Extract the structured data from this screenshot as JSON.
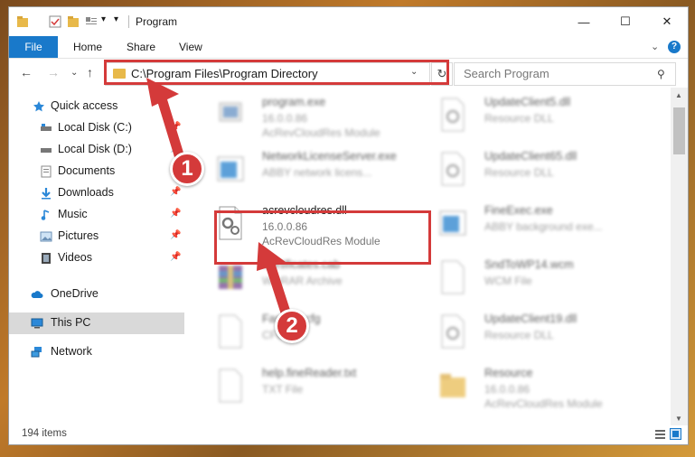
{
  "window": {
    "title": "Program",
    "minimize": "—",
    "maximize": "☐",
    "close": "✕"
  },
  "ribbon": {
    "tabs": [
      "File",
      "Home",
      "Share",
      "View"
    ],
    "expand": "⌄",
    "help": "?"
  },
  "address": {
    "back": "←",
    "forward": "→",
    "dropdown": "⌄",
    "up": "↑",
    "path": "C:\\Program Files\\Program Directory",
    "path_dropdown": "⌄",
    "refresh": "↻",
    "search_placeholder": "Search Program",
    "search_icon": "⚲"
  },
  "sidebar": {
    "items": [
      {
        "label": "Quick access",
        "icon": "star-icon"
      },
      {
        "label": "Local Disk (C:)",
        "icon": "drive-icon"
      },
      {
        "label": "Local Disk (D:)",
        "icon": "drive-icon"
      },
      {
        "label": "Documents",
        "icon": "documents-icon"
      },
      {
        "label": "Downloads",
        "icon": "download-icon"
      },
      {
        "label": "Music",
        "icon": "music-icon"
      },
      {
        "label": "Pictures",
        "icon": "pictures-icon"
      },
      {
        "label": "Videos",
        "icon": "videos-icon"
      },
      {
        "label": "OneDrive",
        "icon": "cloud-icon"
      },
      {
        "label": "This PC",
        "icon": "computer-icon"
      },
      {
        "label": "Network",
        "icon": "network-icon"
      }
    ],
    "pin": "📌"
  },
  "files": [
    {
      "name": "program.exe",
      "line2": "16.0.0.86",
      "line3": "AcRevCloudRes Module",
      "icon": "exe"
    },
    {
      "name": "UpdateClient5.dll",
      "line2": "Resource DLL",
      "line3": "",
      "icon": "dll"
    },
    {
      "name": "NetworkLicenseServer.exe",
      "line2": "ABBY network licens...",
      "line3": "",
      "icon": "app"
    },
    {
      "name": "UpdateClient65.dll",
      "line2": "Resource DLL",
      "line3": "",
      "icon": "dll"
    },
    {
      "name": "acrevcloudres.dll",
      "line2": "16.0.0.86",
      "line3": "AcRevCloudRes Module",
      "icon": "dll"
    },
    {
      "name": "FineExec.exe",
      "line2": "ABBY background exe...",
      "line3": "",
      "icon": "app"
    },
    {
      "name": "Certificates.cab",
      "line2": "WinRAR Archive",
      "line3": "",
      "icon": "archive"
    },
    {
      "name": "SndToWP14.wcm",
      "line2": "WCM File",
      "line3": "",
      "icon": "blank"
    },
    {
      "name": "FastFile.cfg",
      "line2": "CFG File",
      "line3": "",
      "icon": "blank"
    },
    {
      "name": "UpdateClient19.dll",
      "line2": "Resource DLL",
      "line3": "",
      "icon": "dll"
    },
    {
      "name": "help.fineReader.txt",
      "line2": "TXT File",
      "line3": "",
      "icon": "blank"
    },
    {
      "name": "Resource",
      "line2": "16.0.0.86",
      "line3": "AcRevCloudRes Module",
      "icon": "folder"
    }
  ],
  "status": {
    "count": "194 items"
  },
  "callouts": [
    "1",
    "2"
  ],
  "colors": {
    "accent": "#1979ca",
    "highlight": "#d43a3a",
    "folder": "#e8b94a"
  }
}
